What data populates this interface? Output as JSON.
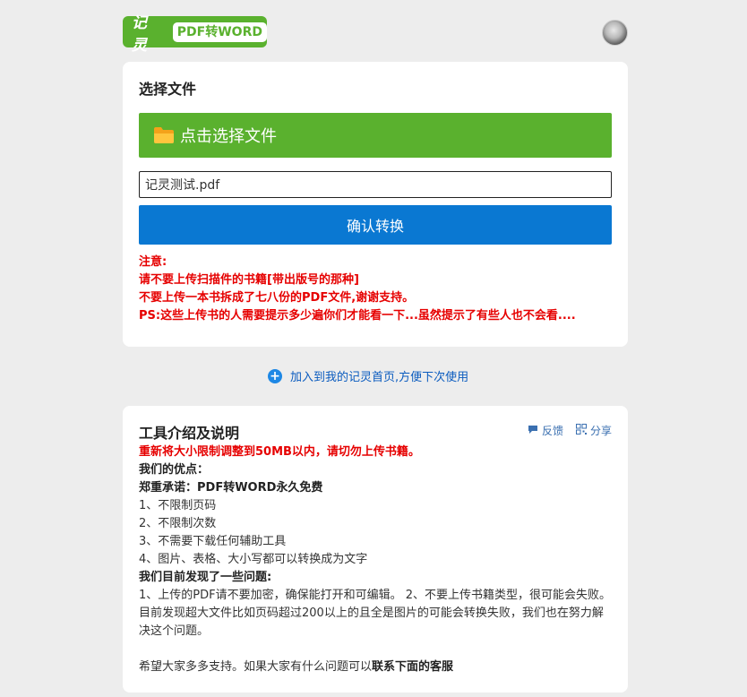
{
  "header": {
    "brand": "记灵",
    "tool_name": "PDF转WORD"
  },
  "upload": {
    "title": "选择文件",
    "select_button": "点击选择文件",
    "file_value": "记灵测试.pdf",
    "confirm_button": "确认转换",
    "notes": [
      "注意:",
      "请不要上传扫描件的书籍[带出版号的那种]",
      "不要上传一本书拆成了七八份的PDF文件,谢谢支持。",
      "PS:这些上传书的人需要提示多少遍你们才能看一下...虽然提示了有些人也不会看...."
    ]
  },
  "add_link": "加入到我的记灵首页,方便下次使用",
  "intro": {
    "title": "工具介绍及说明",
    "feedback": "反馈",
    "share": "分享",
    "warning": "重新将大小限制调整到50MB以内，请切勿上传书籍。",
    "advantages_heading": "我们的优点：",
    "promise": "郑重承诺：PDF转WORD永久免费",
    "advantages": [
      "1、不限制页码",
      "2、不限制次数",
      "3、不需要下载任何辅助工具",
      "4、图片、表格、大小写都可以转换成为文字"
    ],
    "issues_heading": "我们目前发现了一些问题:",
    "issues_text": "1、上传的PDF请不要加密，确保能打开和可编辑。 2、不要上传书籍类型，很可能会失败。目前发现超大文件比如页码超过200以上的且全是图片的可能会转换失败，我们也在努力解决这个问题。",
    "closing_prefix": "希望大家多多支持。如果大家有什么问题可以",
    "closing_bold": "联系下面的客服"
  },
  "colors": {
    "green": "#5ab12e",
    "blue": "#0a78d2",
    "red": "#e60000"
  }
}
